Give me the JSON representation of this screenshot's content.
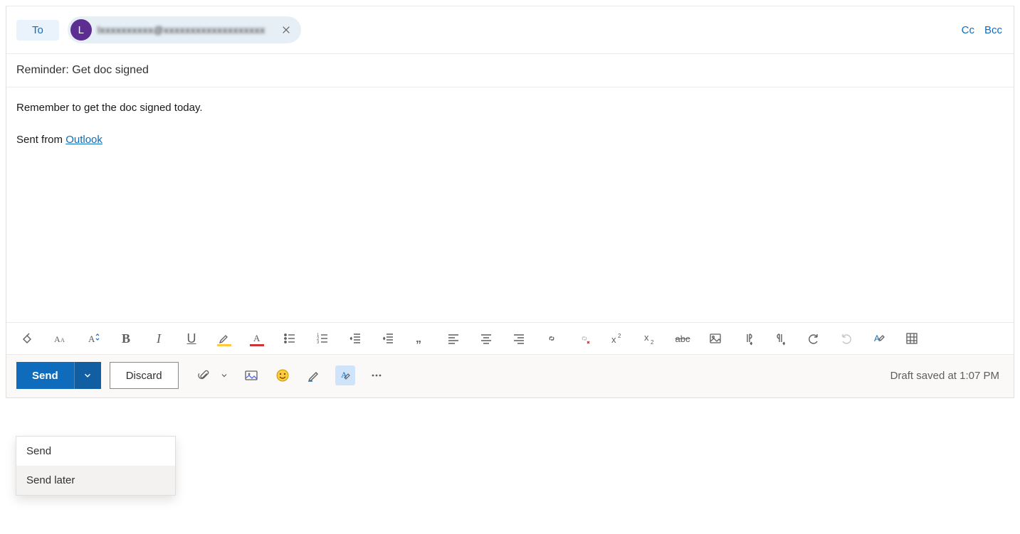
{
  "recipients": {
    "to_label": "To",
    "chip_initial": "L",
    "chip_name": "lxxxxxxxxxx@xxxxxxxxxxxxxxxxxxx",
    "cc_label": "Cc",
    "bcc_label": "Bcc"
  },
  "subject": {
    "value": "Reminder: Get doc signed"
  },
  "body": {
    "line1": "Remember to get the doc signed today.",
    "signature_prefix": "Sent from ",
    "signature_link_text": "Outlook"
  },
  "format_toolbar": {
    "bold": "B",
    "italic": "I",
    "underline": "U",
    "strike": "abc"
  },
  "actions": {
    "send": "Send",
    "discard": "Discard",
    "status": "Draft saved at 1:07 PM"
  },
  "send_menu": {
    "item1": "Send",
    "item2": "Send later"
  }
}
